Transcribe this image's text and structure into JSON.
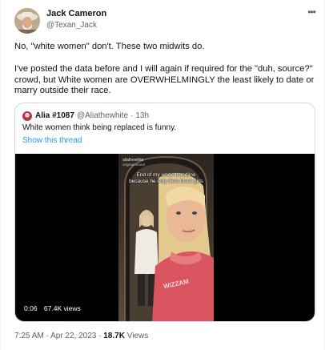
{
  "author": {
    "name": "Jack Cameron",
    "handle": "@Texan_Jack"
  },
  "tweet": {
    "paragraphs": [
      "No, \"white women\" don't. These two midwits do.",
      "I've posted the data before and I will again if required for the \"duh, source?\" crowd, but White women are OVERWHELMINGLY the least likely to date or marry outside their race."
    ]
  },
  "quoted": {
    "name": "Alia #1087",
    "handle": "@Aliathewhite",
    "separator": "·",
    "time": "13h",
    "text": "White women think being replaced is funny.",
    "thread_link": "Show this thread",
    "video": {
      "caption": "End of my white bloodline because he only likes black girls",
      "overlay_name": "aliathewhite",
      "overlay_sub": "original sound",
      "shirt_text": "WIZZAM",
      "duration": "0:06",
      "views": "67.4K views"
    }
  },
  "footer": {
    "time": "7:25 AM",
    "dot1": "·",
    "date": "Apr 22, 2023",
    "dot2": "·",
    "views_count": "18.7K",
    "views_label": "Views"
  },
  "icons": {
    "more": "more-horizontal-icon"
  }
}
